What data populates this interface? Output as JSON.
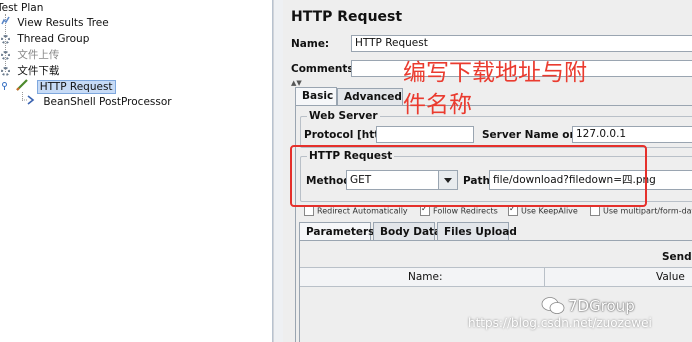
{
  "tree": {
    "items": [
      {
        "label": "Test Plan"
      },
      {
        "label": "View Results Tree"
      },
      {
        "label": "Thread Group"
      },
      {
        "label": "文件上传"
      },
      {
        "label": "文件下载"
      },
      {
        "label": "HTTP Request"
      },
      {
        "label": "BeanShell PostProcessor"
      }
    ]
  },
  "panel": {
    "title": "HTTP Request",
    "name_label": "Name:",
    "name_value": "HTTP Request",
    "comments_label": "Comments:",
    "comments_value": "",
    "tabs": [
      {
        "label": "Basic"
      },
      {
        "label": "Advanced"
      }
    ],
    "web_server": {
      "title": "Web Server",
      "protocol_label": "Protocol [http]:",
      "protocol_value": "",
      "server_label": "Server Name or IP:",
      "server_value": "127.0.0.1"
    },
    "http_request": {
      "title": "HTTP Request",
      "method_label": "Method:",
      "method_value": "GET",
      "path_label": "Path:",
      "path_value": "file/download?filedown=四.png"
    },
    "checkboxes": [
      {
        "label": "Redirect Automatically",
        "checked": false
      },
      {
        "label": "Follow Redirects",
        "checked": true
      },
      {
        "label": "Use KeepAlive",
        "checked": true
      },
      {
        "label": "Use multipart/form-dat",
        "checked": false
      }
    ],
    "param_tabs": [
      {
        "label": "Parameters"
      },
      {
        "label": "Body Data"
      },
      {
        "label": "Files Upload"
      }
    ],
    "send_label": "Send I",
    "columns": [
      {
        "label": "Name:"
      },
      {
        "label": "Value"
      }
    ]
  },
  "annotation": {
    "line1": "编写下载地址与附",
    "line2": "件名称",
    "color": "#e5302b"
  },
  "watermark": {
    "brand": "7DGroup",
    "url": "https://blog.csdn.net/zuozewei"
  }
}
